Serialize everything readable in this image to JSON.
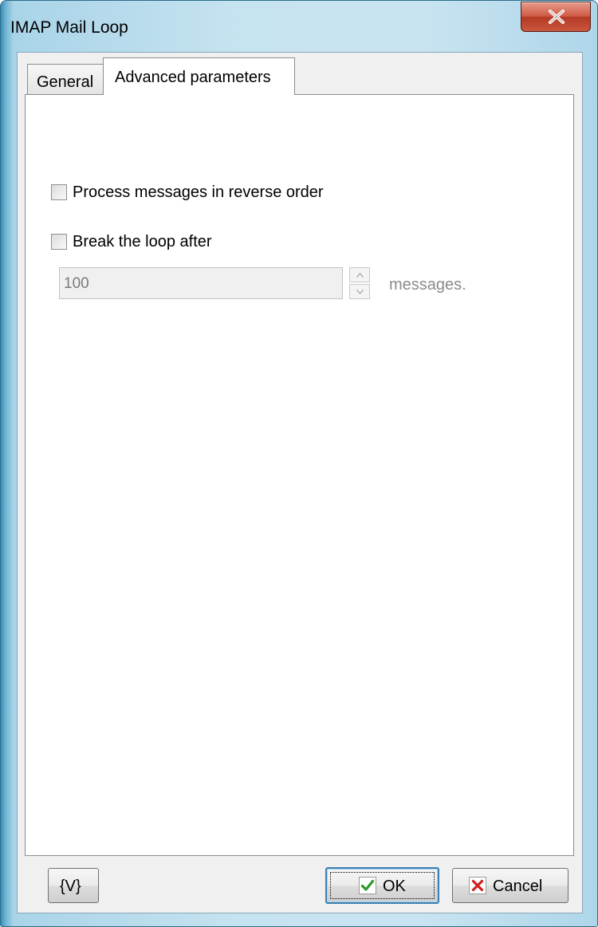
{
  "window": {
    "title": "IMAP Mail Loop"
  },
  "tabs": [
    {
      "label": "General",
      "active": false
    },
    {
      "label": "Advanced parameters",
      "active": true
    }
  ],
  "options": {
    "reverse_order": {
      "label": "Process messages in reverse order",
      "checked": false
    },
    "break_loop": {
      "label": "Break the loop after",
      "checked": false
    },
    "message_count": {
      "value": "100",
      "disabled": true
    },
    "suffix": "messages."
  },
  "footer": {
    "variables_label": "{V}",
    "ok_label": "OK",
    "cancel_label": "Cancel"
  },
  "icons": {
    "close": "close-icon",
    "ok": "check-icon",
    "cancel": "x-icon",
    "spin_up": "chevron-up-icon",
    "spin_down": "chevron-down-icon"
  },
  "colors": {
    "close_button": "#c9563d",
    "ok_check": "#2a9a2a",
    "cancel_x": "#d21f1f",
    "focus_border": "#3c7fb1"
  }
}
